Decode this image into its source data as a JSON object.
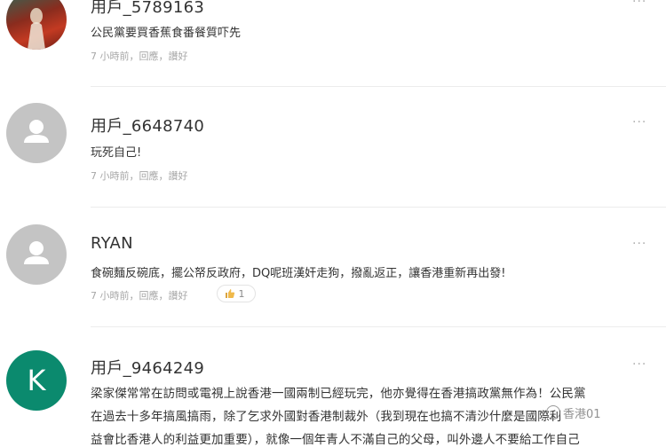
{
  "comments": [
    {
      "username": "用戶_5789163",
      "text": "公民黨要買香蕉食番餐質吓先",
      "time": "7 小時前",
      "reply": "回應",
      "like": "讚好",
      "more": "···"
    },
    {
      "username": "用戶_6648740",
      "text": "玩死自己!",
      "time": "7 小時前",
      "reply": "回應",
      "like": "讚好",
      "more": "···"
    },
    {
      "username": "RYAN",
      "text": "食碗麵反碗底，擺公帑反政府，DQ呢班漢奸走狗，撥亂返正，讓香港重新再出發!",
      "time": "7 小時前",
      "reply": "回應",
      "like": "讚好",
      "like_count": "1",
      "more": "···"
    },
    {
      "username": "用戶_9464249",
      "avatar_letter": "K",
      "lines": [
        "梁家傑常常在訪問或電視上說香港一國兩制已經玩完，他亦覺得在香港搞政黨無作為！公民黨",
        "在過去十多年搞風搞雨，除了乞求外國對香港制裁外（我到現在也搞不清沙什麼是國際利",
        "益會比香港人的利益更加重要），就像一個年青人不滿自己的父母，叫外邊人不要給工作自己"
      ],
      "more": "···"
    }
  ],
  "watermark": "香港01"
}
